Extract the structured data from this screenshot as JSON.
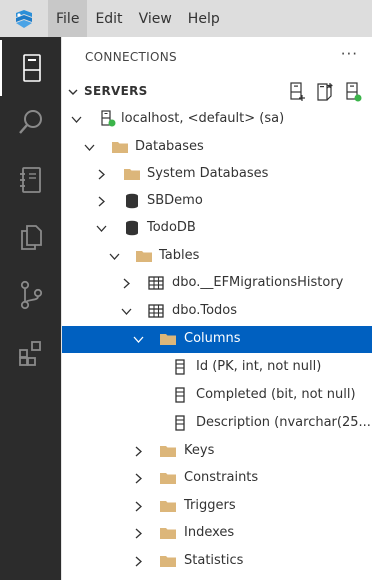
{
  "menu": {
    "logo_icon": "azure-data-studio-logo",
    "items": [
      {
        "label": "File"
      },
      {
        "label": "Edit"
      },
      {
        "label": "View"
      },
      {
        "label": "Help"
      }
    ]
  },
  "activity": {
    "items": [
      "servers-icon",
      "search-icon",
      "notebook-icon",
      "copy-icon",
      "source-control-icon",
      "extensions-icon"
    ]
  },
  "panel": {
    "title": "CONNECTIONS",
    "more": "···",
    "section_label": "SERVERS",
    "actions": [
      "new-connection-icon",
      "new-server-group-icon",
      "active-connections-icon"
    ]
  },
  "tree": [
    {
      "label": "localhost, <default> (sa)",
      "icon": "server-connected-icon",
      "expanded": true
    },
    {
      "label": "Databases",
      "icon": "folder-icon",
      "expanded": true
    },
    {
      "label": "System Databases",
      "icon": "folder-icon",
      "expanded": false
    },
    {
      "label": "SBDemo",
      "icon": "database-icon",
      "expanded": false
    },
    {
      "label": "TodoDB",
      "icon": "database-icon",
      "expanded": true
    },
    {
      "label": "Tables",
      "icon": "folder-icon",
      "expanded": true
    },
    {
      "label": "dbo.__EFMigrationsHistory",
      "icon": "table-icon",
      "expanded": false
    },
    {
      "label": "dbo.Todos",
      "icon": "table-icon",
      "expanded": true
    },
    {
      "label": "Columns",
      "icon": "folder-icon",
      "expanded": true,
      "selected": true
    },
    {
      "label": "Id (PK, int, not null)",
      "icon": "column-icon"
    },
    {
      "label": "Completed (bit, not null)",
      "icon": "column-icon"
    },
    {
      "label": "Description (nvarchar(25...",
      "icon": "column-icon"
    },
    {
      "label": "Keys",
      "icon": "folder-icon",
      "expanded": false
    },
    {
      "label": "Constraints",
      "icon": "folder-icon",
      "expanded": false
    },
    {
      "label": "Triggers",
      "icon": "folder-icon",
      "expanded": false
    },
    {
      "label": "Indexes",
      "icon": "folder-icon",
      "expanded": false
    },
    {
      "label": "Statistics",
      "icon": "folder-icon",
      "expanded": false
    }
  ],
  "colors": {
    "selection": "#0060c0",
    "activity_bar": "#2c2c2c",
    "menubar": "#dddddd",
    "folder": "#dcb67a",
    "connected": "#3bb44a"
  }
}
